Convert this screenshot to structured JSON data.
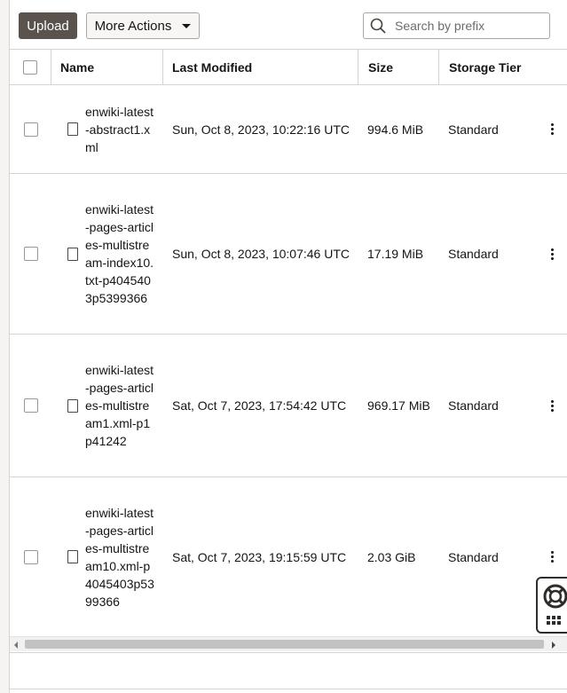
{
  "toolbar": {
    "upload_label": "Upload",
    "more_actions_label": "More Actions",
    "search_placeholder": "Search by prefix"
  },
  "table": {
    "columns": [
      "Name",
      "Last Modified",
      "Size",
      "Storage Tier"
    ],
    "rows": [
      {
        "name": "enwiki-latest-abstract1.xml",
        "modified": "Sun, Oct 8, 2023, 10:22:16 UTC",
        "size": "994.6 MiB",
        "tier": "Standard"
      },
      {
        "name": "enwiki-latest-pages-articles-multistream-index10.txt-p4045403p5399366",
        "modified": "Sun, Oct 8, 2023, 10:07:46 UTC",
        "size": "17.19 MiB",
        "tier": "Standard"
      },
      {
        "name": "enwiki-latest-pages-articles-multistream1.xml-p1p41242",
        "modified": "Sat, Oct 7, 2023, 17:54:42 UTC",
        "size": "969.17 MiB",
        "tier": "Standard"
      },
      {
        "name": "enwiki-latest-pages-articles-multistream10.xml-p4045403p5399366",
        "modified": "Sat, Oct 7, 2023, 19:15:59 UTC",
        "size": "2.03 GiB",
        "tier": "Standard"
      }
    ]
  },
  "icons": {
    "search": "search-icon",
    "file": "file-icon",
    "row_actions": "kebab-icon",
    "help": "lifebuoy-icon",
    "apps": "grid-icon"
  },
  "colors": {
    "primary_button": "#5a534d",
    "border": "#d6d3cf",
    "text": "#161513"
  }
}
